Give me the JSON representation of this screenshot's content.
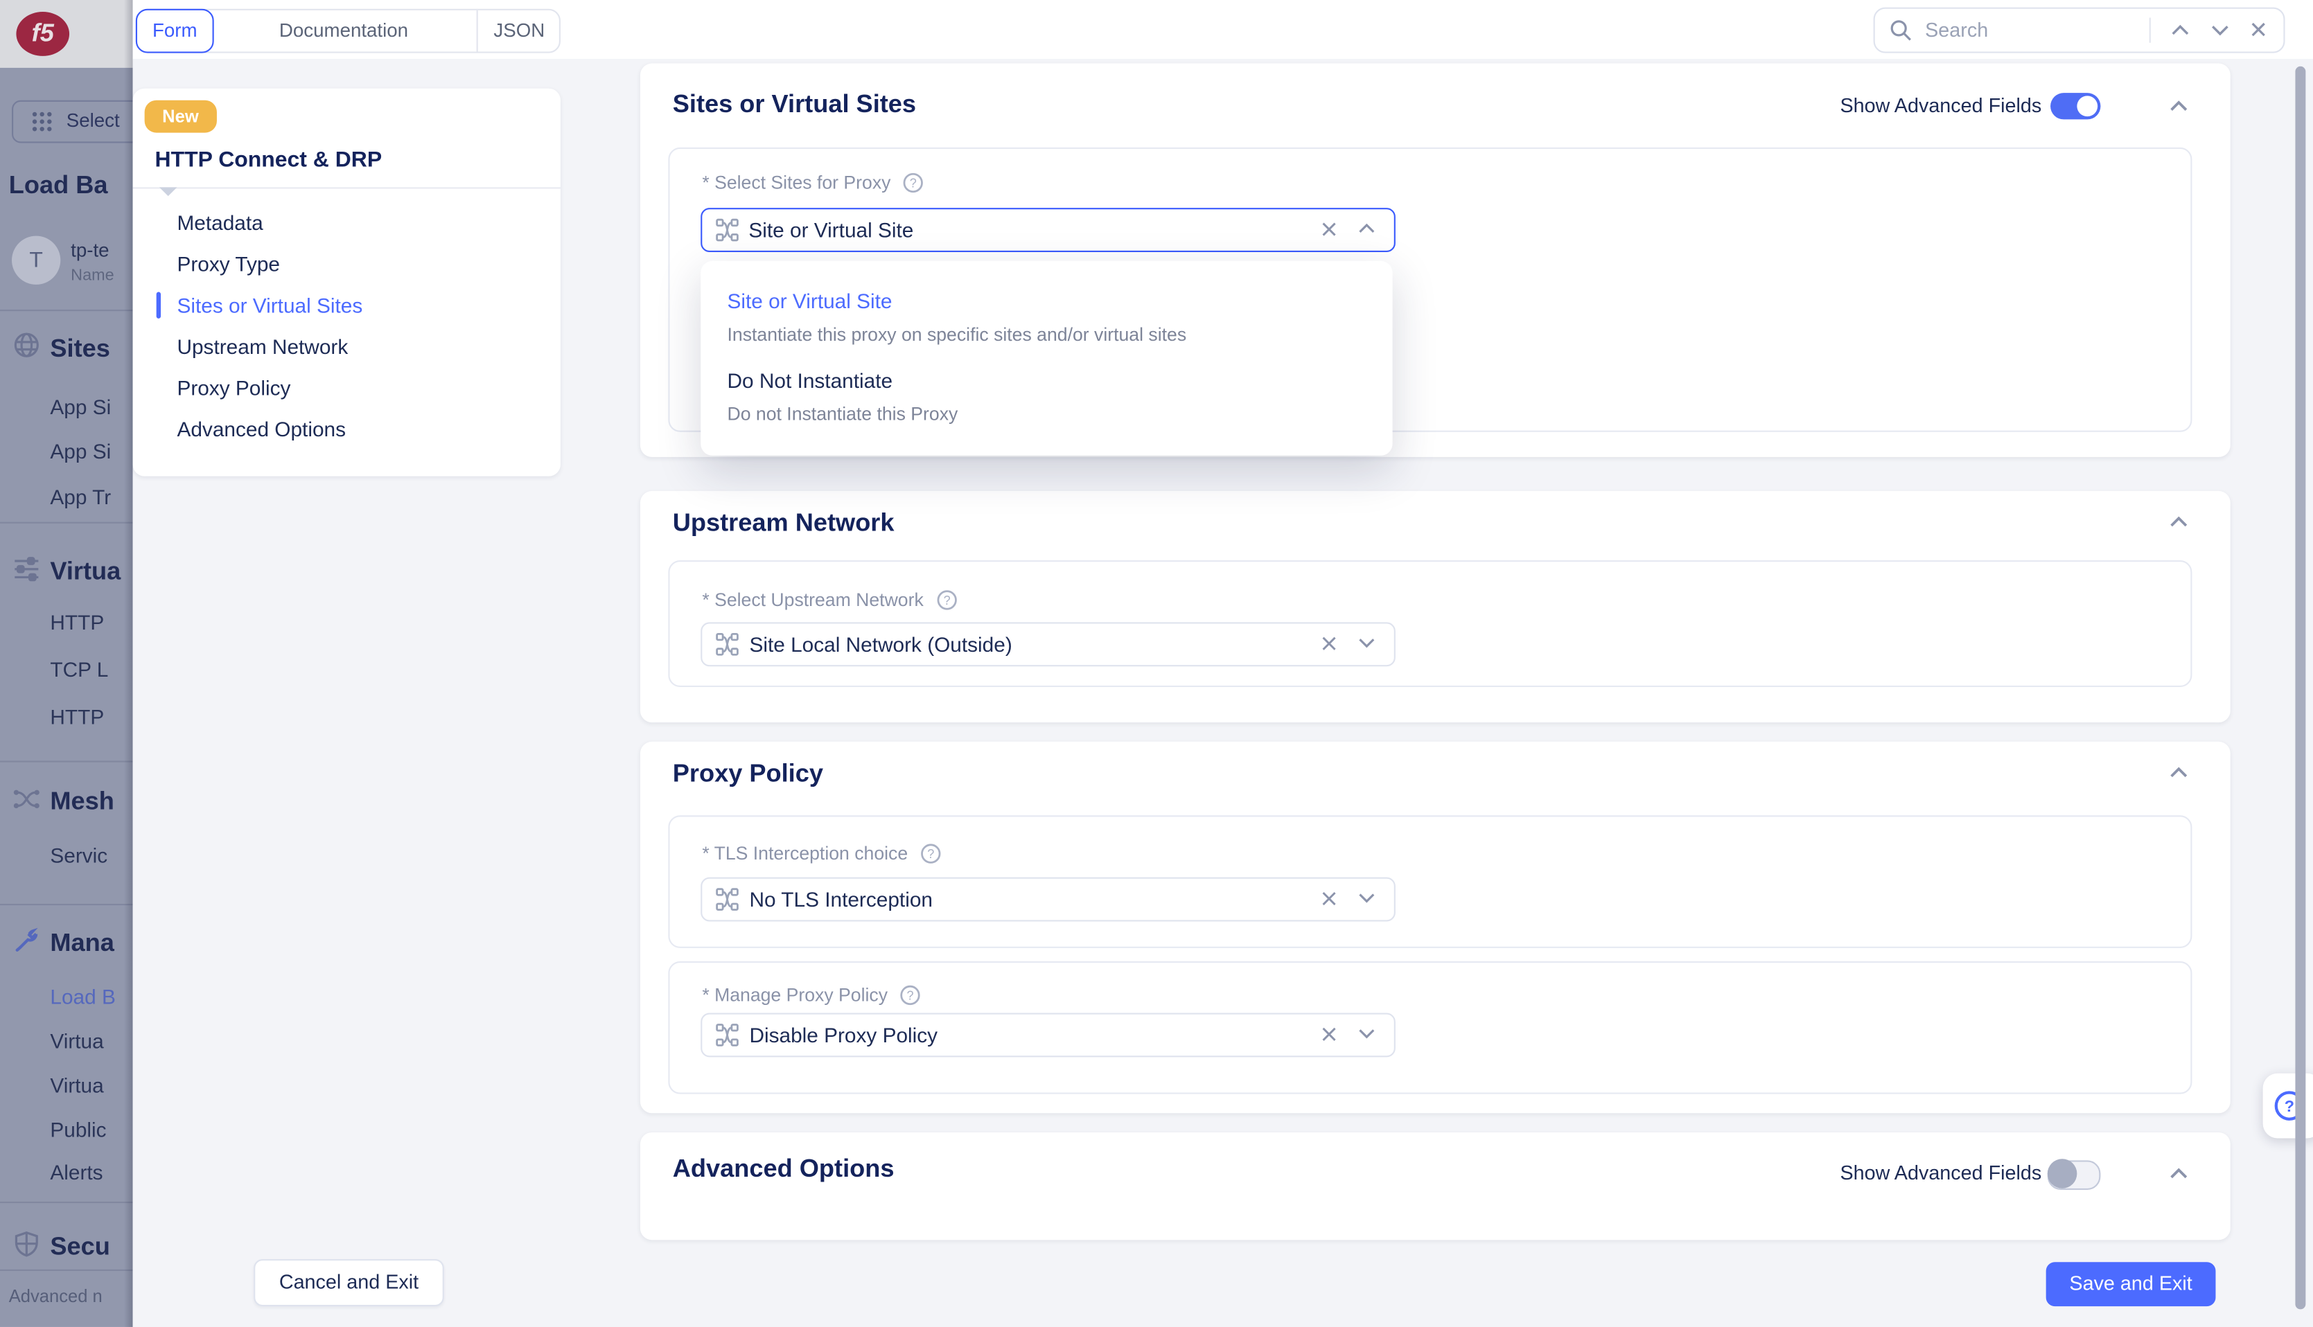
{
  "colors": {
    "accent_blue": "#4c6bff",
    "focus_border": "#3b5bfd",
    "badge_yellow": "#f2b84a",
    "navy_text": "#14235c",
    "label_gray": "#8a92a8",
    "card_border": "#e6e9f2",
    "content_bg": "#f3f4f8",
    "sidebar_dimmed_bg": "#9298ad",
    "logo_red": "#9c2742",
    "toggle_on": "#4f6df5"
  },
  "topbar": {
    "tabs": [
      "Form",
      "Documentation",
      "JSON"
    ],
    "search_placeholder": "Search"
  },
  "sidebar": {
    "app_switcher_label": "Select",
    "section_title": "Load Ba",
    "tenant": {
      "avatar_letter": "T",
      "line1": "tp-te",
      "line2": "Name"
    },
    "groups": [
      {
        "label": "Sites",
        "items": [
          "App Si",
          "App Si",
          "App Tr"
        ]
      },
      {
        "label": "Virtua",
        "items": [
          "HTTP",
          "TCP L",
          "HTTP"
        ]
      },
      {
        "label": "Mesh",
        "items": [
          "Servic"
        ]
      },
      {
        "label": "Mana",
        "items": [
          "Load B",
          "Virtua",
          "Virtua",
          "Public",
          "Alerts"
        ]
      },
      {
        "label": "Secu",
        "items": []
      }
    ],
    "footer_note": "Advanced n"
  },
  "wizard": {
    "badge": "New",
    "title": "HTTP Connect & DRP",
    "steps": [
      "Metadata",
      "Proxy Type",
      "Sites or Virtual Sites",
      "Upstream Network",
      "Proxy Policy",
      "Advanced Options"
    ]
  },
  "form": {
    "show_advanced_label": "Show Advanced Fields",
    "sites": {
      "heading": "Sites or Virtual Sites",
      "field_label": "* Select Sites for Proxy",
      "value": "Site or Virtual Site",
      "menu": [
        {
          "title": "Site or Virtual Site",
          "desc": "Instantiate this proxy on specific sites and/or virtual sites"
        },
        {
          "title": "Do Not Instantiate",
          "desc": "Do not Instantiate this Proxy"
        }
      ]
    },
    "upstream": {
      "heading": "Upstream Network",
      "field_label": "* Select Upstream Network",
      "value": "Site Local Network (Outside)"
    },
    "proxy_policy": {
      "heading": "Proxy Policy",
      "tls_label": "* TLS Interception choice",
      "tls_value": "No TLS Interception",
      "manage_label": "* Manage Proxy Policy",
      "manage_value": "Disable Proxy Policy"
    },
    "advanced": {
      "heading": "Advanced Options"
    }
  },
  "footer": {
    "cancel_label": "Cancel and Exit",
    "save_label": "Save and Exit"
  }
}
